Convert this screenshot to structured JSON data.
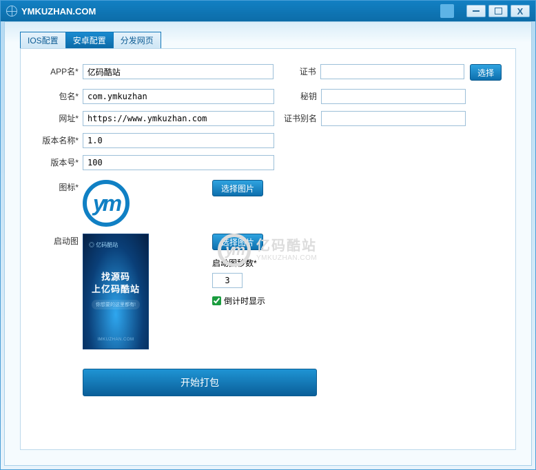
{
  "title": "YMKUZHAN.COM",
  "tabs": [
    "IOS配置",
    "安卓配置",
    "分发网页"
  ],
  "activeTab": 1,
  "labels": {
    "appName": "APP名*",
    "package": "包名*",
    "url": "网址*",
    "versionName": "版本名称*",
    "versionCode": "版本号*",
    "icon": "图标*",
    "splash": "启动图",
    "cert": "证书",
    "key": "秘钥",
    "alias": "证书别名",
    "splashSeconds": "启动图秒数*",
    "countdown": "倒计时显示"
  },
  "values": {
    "appName": "亿码酷站",
    "package": "com.ymkuzhan",
    "url": "https://www.ymkuzhan.com",
    "versionName": "1.0",
    "versionCode": "100",
    "cert": "",
    "key": "",
    "alias": "",
    "splashSeconds": "3"
  },
  "buttons": {
    "selectCert": "选择",
    "selectImage": "选择图片",
    "start": "开始打包"
  },
  "splashPreview": {
    "logo": "◎ 亿码酷站",
    "line1": "找源码",
    "line2": "上亿码酷站",
    "sub": "你想要的这里都有!",
    "foot": "IMKUZHAN.COM"
  },
  "watermark": {
    "cn": "亿码酷站",
    "en": "YMKUZHAN.COM"
  },
  "countdownChecked": true
}
